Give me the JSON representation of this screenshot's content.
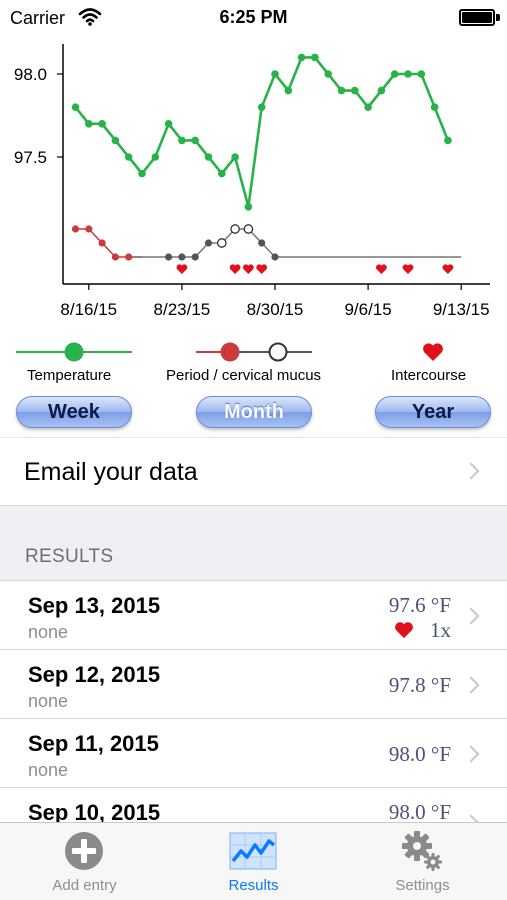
{
  "status_bar": {
    "carrier": "Carrier",
    "time": "6:25 PM"
  },
  "chart_data": {
    "type": "line",
    "title": "",
    "xlabel": "",
    "ylabel": "",
    "x_ticks": [
      "8/16/15",
      "8/23/15",
      "8/30/15",
      "9/6/15",
      "9/13/15"
    ],
    "y_ticks": [
      "97.5",
      "98.0"
    ],
    "ylim": [
      97.0,
      98.2
    ],
    "x_dates": [
      "8/15",
      "8/16",
      "8/17",
      "8/18",
      "8/19",
      "8/20",
      "8/21",
      "8/22",
      "8/23",
      "8/24",
      "8/25",
      "8/26",
      "8/27",
      "8/28",
      "8/29",
      "8/30",
      "8/31",
      "9/1",
      "9/2",
      "9/3",
      "9/4",
      "9/5",
      "9/6",
      "9/7",
      "9/8",
      "9/9",
      "9/10",
      "9/11",
      "9/12",
      "9/13"
    ],
    "series": [
      {
        "name": "Temperature",
        "color": "#27b24a",
        "values": [
          97.8,
          97.7,
          97.7,
          97.6,
          97.5,
          97.4,
          97.5,
          97.7,
          97.6,
          97.6,
          97.5,
          97.4,
          97.5,
          97.2,
          97.8,
          98.0,
          97.9,
          98.1,
          98.1,
          98.0,
          97.9,
          97.9,
          97.8,
          97.9,
          98.0,
          98.0,
          98.0,
          97.8,
          97.6
        ]
      }
    ],
    "period_cervical_mucus": {
      "colors": {
        "period": "#cc3b3b",
        "mucus": "#555555",
        "open": "#ffffff"
      },
      "markers": [
        {
          "date": "8/15",
          "kind": "period",
          "level": 2
        },
        {
          "date": "8/16",
          "kind": "period",
          "level": 2
        },
        {
          "date": "8/17",
          "kind": "period",
          "level": 1
        },
        {
          "date": "8/18",
          "kind": "period",
          "level": 0
        },
        {
          "date": "8/19",
          "kind": "period",
          "level": 0
        },
        {
          "date": "8/22",
          "kind": "mucus",
          "level": 0
        },
        {
          "date": "8/23",
          "kind": "mucus",
          "level": 0
        },
        {
          "date": "8/24",
          "kind": "mucus",
          "level": 0
        },
        {
          "date": "8/25",
          "kind": "mucus",
          "level": 1
        },
        {
          "date": "8/26",
          "kind": "open",
          "level": 1
        },
        {
          "date": "8/27",
          "kind": "open",
          "level": 2
        },
        {
          "date": "8/28",
          "kind": "open",
          "level": 2
        },
        {
          "date": "8/29",
          "kind": "mucus",
          "level": 1
        },
        {
          "date": "8/30",
          "kind": "mucus",
          "level": 0
        }
      ]
    },
    "intercourse_dates": [
      "8/23",
      "8/27",
      "8/28",
      "8/29",
      "9/7",
      "9/9",
      "9/12"
    ]
  },
  "legend": {
    "temperature": "Temperature",
    "period": "Period / cervical mucus",
    "intercourse": "Intercourse"
  },
  "range_buttons": [
    {
      "label": "Week",
      "selected": false
    },
    {
      "label": "Month",
      "selected": true
    },
    {
      "label": "Year",
      "selected": false
    }
  ],
  "email_row": {
    "label": "Email your data"
  },
  "results": {
    "header": "RESULTS",
    "rows": [
      {
        "date": "Sep 13, 2015",
        "note": "none",
        "temp": "97.6 °F",
        "intercourse": "1x"
      },
      {
        "date": "Sep 12, 2015",
        "note": "none",
        "temp": "97.8 °F",
        "intercourse": ""
      },
      {
        "date": "Sep 11, 2015",
        "note": "none",
        "temp": "98.0 °F",
        "intercourse": ""
      },
      {
        "date": "Sep 10, 2015",
        "note": "",
        "temp": "98.0 °F",
        "intercourse": ""
      }
    ]
  },
  "tab_bar": {
    "tabs": [
      {
        "label": "Add entry",
        "icon": "plus-circle-icon",
        "active": false
      },
      {
        "label": "Results",
        "icon": "chart-icon",
        "active": true
      },
      {
        "label": "Settings",
        "icon": "gear-icon",
        "active": false
      }
    ]
  }
}
